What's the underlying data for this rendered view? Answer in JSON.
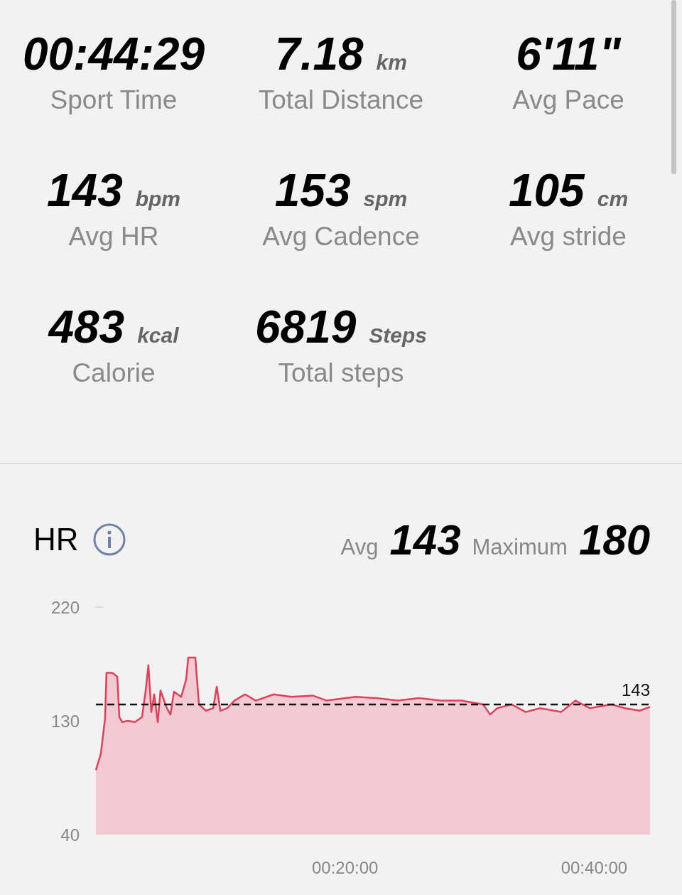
{
  "stats": [
    {
      "value": "00:44:29",
      "label": "Sport Time"
    },
    {
      "value": "7.18",
      "unit": "km",
      "label": "Total Distance"
    },
    {
      "value": "6'11\"",
      "label": "Avg Pace"
    },
    {
      "value": "143",
      "unit": "bpm",
      "label": "Avg HR"
    },
    {
      "value": "153",
      "unit": "spm",
      "label": "Avg Cadence"
    },
    {
      "value": "105",
      "unit": "cm",
      "label": "Avg stride"
    },
    {
      "value": "483",
      "unit": "kcal",
      "label": "Calorie"
    },
    {
      "value": "6819",
      "unit": "Steps",
      "label": "Total steps"
    }
  ],
  "hr": {
    "title": "HR",
    "avg_label": "Avg",
    "avg_value": "143",
    "max_label": "Maximum",
    "max_value": "180",
    "chart_data": {
      "type": "area",
      "xlim": [
        0,
        2669
      ],
      "ylim": [
        40,
        220
      ],
      "yticks": [
        40,
        130,
        220
      ],
      "xticks": [
        {
          "value": 1200,
          "label": "00:20:00"
        },
        {
          "value": 2400,
          "label": "00:40:00"
        }
      ],
      "series": [
        {
          "color": "#e0405a",
          "x": [
            0,
            24,
            44,
            51,
            79,
            103,
            113,
            127,
            154,
            188,
            222,
            240,
            253,
            267,
            281,
            298,
            311,
            342,
            359,
            376,
            411,
            435,
            445,
            479,
            496,
            530,
            565,
            582,
            599,
            633,
            667,
            719,
            770,
            856,
            941,
            1044,
            1112,
            1249,
            1352,
            1454,
            1557,
            1660,
            1762,
            1865,
            1899,
            1933,
            2002,
            2070,
            2139,
            2241,
            2310,
            2378,
            2481,
            2549,
            2618,
            2669
          ],
          "values": [
            91,
            104,
            132,
            168,
            168,
            165,
            133,
            129,
            130,
            129,
            133,
            154,
            174,
            137,
            151,
            129,
            154,
            140,
            135,
            153,
            149,
            163,
            180,
            180,
            143,
            138,
            140,
            157,
            138,
            140,
            146,
            151,
            146,
            151,
            149,
            150,
            146,
            149,
            148,
            146,
            148,
            146,
            146,
            143,
            135,
            140,
            143,
            137,
            140,
            137,
            146,
            140,
            143,
            140,
            138,
            141
          ]
        },
        {
          "name": "143",
          "type": "line",
          "line_style": "dashed",
          "color": "#111111",
          "x": [
            0,
            2669
          ],
          "values": [
            143,
            143
          ]
        }
      ]
    }
  }
}
